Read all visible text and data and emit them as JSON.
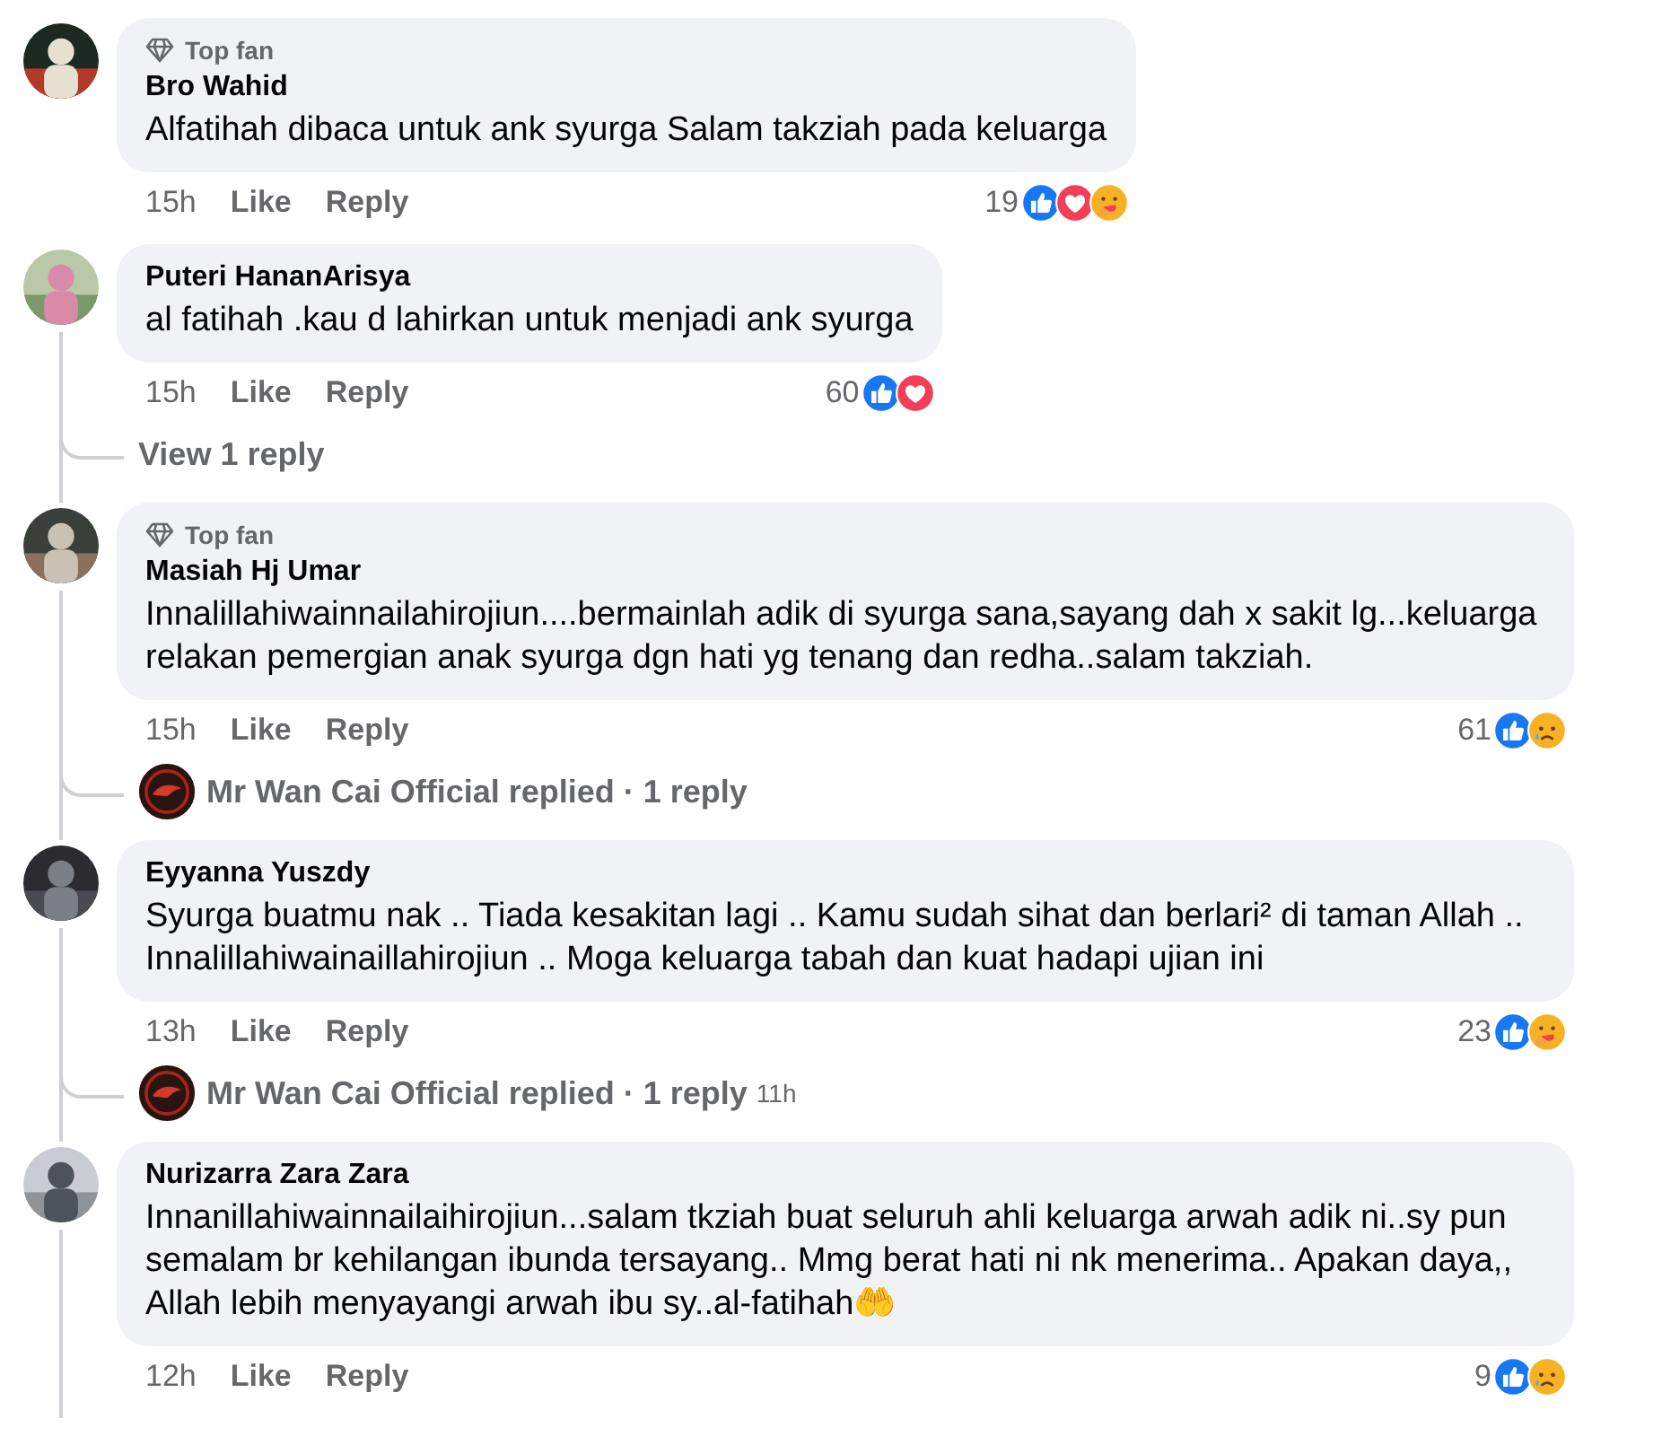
{
  "comments": [
    {
      "badge": "Top fan",
      "name": "Bro Wahid",
      "text": "Alfatihah dibaca untuk ank syurga Salam takziah pada keluarga",
      "time": "15h",
      "like": "Like",
      "reply": "Reply",
      "count": "19",
      "reactions": [
        {
          "kind": "like"
        },
        {
          "kind": "love"
        },
        {
          "kind": "care"
        }
      ],
      "thread_line": false
    },
    {
      "name": "Puteri HananArisya",
      "text": "al fatihah .kau d lahirkan untuk menjadi ank syurga",
      "time": "15h",
      "like": "Like",
      "reply": "Reply",
      "count": "60",
      "reactions": [
        {
          "kind": "like"
        },
        {
          "kind": "love"
        }
      ],
      "thread_line": true,
      "replies": [
        {
          "kind": "view",
          "text": "View 1 reply"
        }
      ]
    },
    {
      "badge": "Top fan",
      "name": "Masiah Hj Umar",
      "text": "Innalillahiwainnailahirojiun....bermainlah adik di syurga sana,sayang dah x sakit lg...keluarga relakan pemergian anak syurga dgn hati yg tenang dan redha..salam takziah.",
      "time": "15h",
      "like": "Like",
      "reply": "Reply",
      "count": "61",
      "reactions": [
        {
          "kind": "like"
        },
        {
          "kind": "sad"
        }
      ],
      "thread_line": true,
      "replies": [
        {
          "kind": "replied",
          "text": "Mr Wan Cai Official replied · 1 reply"
        }
      ]
    },
    {
      "name": "Eyyanna Yuszdy",
      "text": "Syurga buatmu nak .. Tiada kesakitan lagi .. Kamu sudah sihat dan berlari² di taman Allah .. Innalillahiwainaillahirojiun .. Moga keluarga tabah dan kuat hadapi ujian ini",
      "time": "13h",
      "like": "Like",
      "reply": "Reply",
      "count": "23",
      "reactions": [
        {
          "kind": "like"
        },
        {
          "kind": "care"
        }
      ],
      "thread_line": true,
      "replies": [
        {
          "kind": "replied",
          "text": "Mr Wan Cai Official replied · 1 reply",
          "time": "11h"
        }
      ]
    },
    {
      "name": "Nurizarra Zara Zara",
      "text": "Innanillahiwainnailaihirojiun...salam tkziah buat seluruh ahli keluarga arwah adik ni..sy pun semalam br kehilangan ibunda tersayang.. Mmg berat hati ni nk menerima.. Apakan daya,, Allah lebih menyayangi arwah ibu sy..al-fatihah🤲",
      "time": "12h",
      "like": "Like",
      "reply": "Reply",
      "count": "9",
      "reactions": [
        {
          "kind": "like"
        },
        {
          "kind": "sad"
        }
      ],
      "thread_line": true
    }
  ]
}
